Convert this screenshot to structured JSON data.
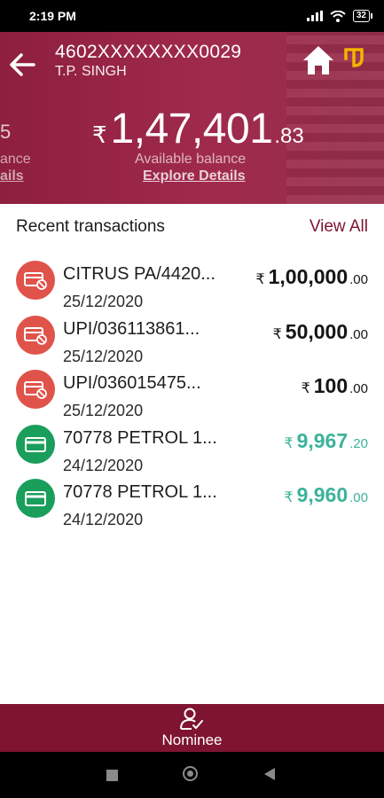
{
  "status_bar": {
    "time": "2:19 PM",
    "battery": "32"
  },
  "header": {
    "account_number": "4602XXXXXXXX0029",
    "account_name": "T.P. SINGH",
    "prev_card": {
      "amount": "5",
      "label": "ance",
      "link": "ails"
    },
    "balance": {
      "currency": "₹",
      "main": "1,47,401",
      "decimal": ".83",
      "label": "Available balance",
      "link": "Explore Details"
    }
  },
  "transactions": {
    "title": "Recent transactions",
    "view_all": "View All",
    "items": [
      {
        "type": "debit",
        "title": "CITRUS PA/4420...",
        "date": "25/12/2020",
        "currency": "₹",
        "amount": "1,00,000",
        "decimal": ".00"
      },
      {
        "type": "debit",
        "title": "UPI/036113861...",
        "date": "25/12/2020",
        "currency": "₹",
        "amount": "50,000",
        "decimal": ".00"
      },
      {
        "type": "debit",
        "title": "UPI/036015475...",
        "date": "25/12/2020",
        "currency": "₹",
        "amount": "100",
        "decimal": ".00"
      },
      {
        "type": "credit",
        "title": "70778 PETROL 1...",
        "date": "24/12/2020",
        "currency": "₹",
        "amount": "9,967",
        "decimal": ".20"
      },
      {
        "type": "credit",
        "title": "70778 PETROL 1...",
        "date": "24/12/2020",
        "currency": "₹",
        "amount": "9,960",
        "decimal": ".00"
      }
    ]
  },
  "bottom_nav": {
    "nominee_label": "Nominee"
  },
  "colors": {
    "header": "#9b2648",
    "debit": "#e0534a",
    "credit": "#1a9e5c",
    "credit_text": "#3bb39a",
    "accent": "#7e1430"
  }
}
